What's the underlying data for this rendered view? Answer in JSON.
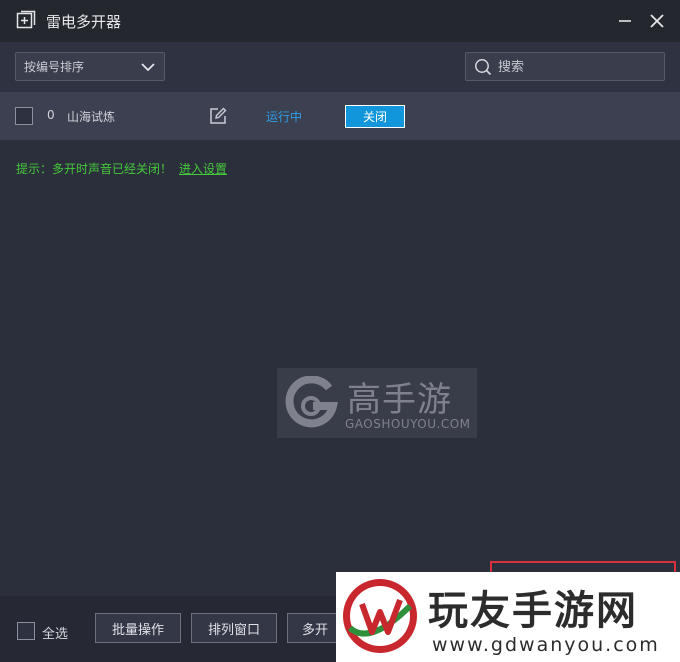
{
  "window": {
    "title": "雷电多开器",
    "icon": "plus-square-icon",
    "minimize_icon": "minimize-icon",
    "close_icon": "close-icon"
  },
  "toolbar": {
    "sort_value": "按编号排序",
    "sort_icon": "chevron-down-icon",
    "search_placeholder": "搜索",
    "search_icon": "search-icon"
  },
  "instances": [
    {
      "selected": false,
      "index": "0",
      "name": "山海试炼",
      "edit_icon": "edit-icon",
      "status": "运行中",
      "close_label": "关闭"
    }
  ],
  "hint": {
    "text": "提示：多开时声音已经关闭！",
    "link": "进入设置"
  },
  "watermark_gaoshouyou": {
    "title": "高手游",
    "subtitle": "GAOSHOUYOU.COM"
  },
  "footer": {
    "select_all_label": "全选",
    "batch_button": "批量操作",
    "arrange_button": "排列窗口",
    "multi_button": "多开"
  },
  "watermark_gdwanyou": {
    "title": "玩友手游网",
    "subtitle": "www.gdwanyou.com"
  },
  "colors": {
    "accent": "#1296db",
    "status_running": "#2e9fe6",
    "hint_green": "#45c93b",
    "highlight_red": "#d9313c",
    "background": "#2b2e3b"
  }
}
